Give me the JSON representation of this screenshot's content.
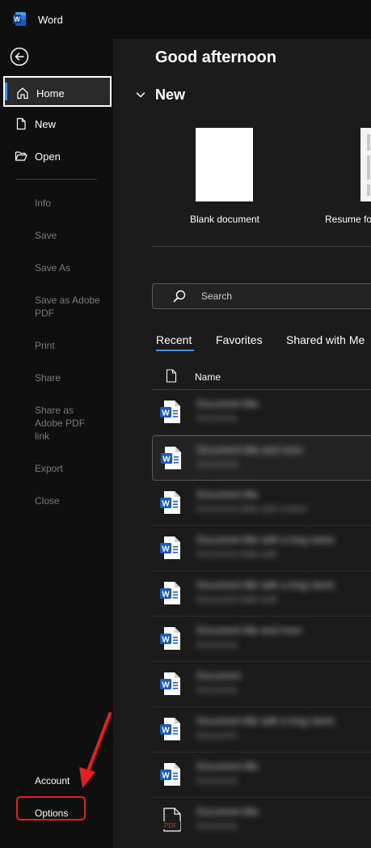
{
  "app": {
    "title": "Word"
  },
  "sidebar": {
    "nav": [
      {
        "label": "Home",
        "icon": "home-icon"
      },
      {
        "label": "New",
        "icon": "new-document-icon"
      },
      {
        "label": "Open",
        "icon": "folder-open-icon"
      }
    ],
    "secondary": [
      "Info",
      "Save",
      "Save As",
      "Save as Adobe PDF",
      "Print",
      "Share",
      "Share as Adobe PDF link",
      "Export",
      "Close"
    ],
    "bottom": [
      "Account",
      "Options"
    ]
  },
  "main": {
    "greeting": "Good afternoon",
    "new_heading": "New",
    "templates": [
      "Blank document",
      "Resume fo"
    ],
    "search": {
      "placeholder": "Search"
    },
    "tabs": [
      "Recent",
      "Favorites",
      "Shared with Me"
    ],
    "list": {
      "column_name": "Name",
      "files": [
        {
          "title": "Document title",
          "subtitle": "Documents"
        },
        {
          "title": "Document title and more",
          "subtitle": "Documents"
        },
        {
          "title": "Document title",
          "subtitle": "Documents folder path location"
        },
        {
          "title": "Document title with a long name",
          "subtitle": "Documents folder path"
        },
        {
          "title": "Document title with a long name",
          "subtitle": "Documents folder path"
        },
        {
          "title": "Document title and more",
          "subtitle": "Documents"
        },
        {
          "title": "Document",
          "subtitle": "Documents"
        },
        {
          "title": "Document title with a long name",
          "subtitle": "Documents"
        },
        {
          "title": "Document title",
          "subtitle": "Documents"
        },
        {
          "title": "Document title",
          "subtitle": "Documents"
        }
      ]
    }
  },
  "colors": {
    "accent": "#4a90e2",
    "highlight": "#e81e1e",
    "word_blue": "#185abd",
    "pdf_red": "#d9302c"
  }
}
